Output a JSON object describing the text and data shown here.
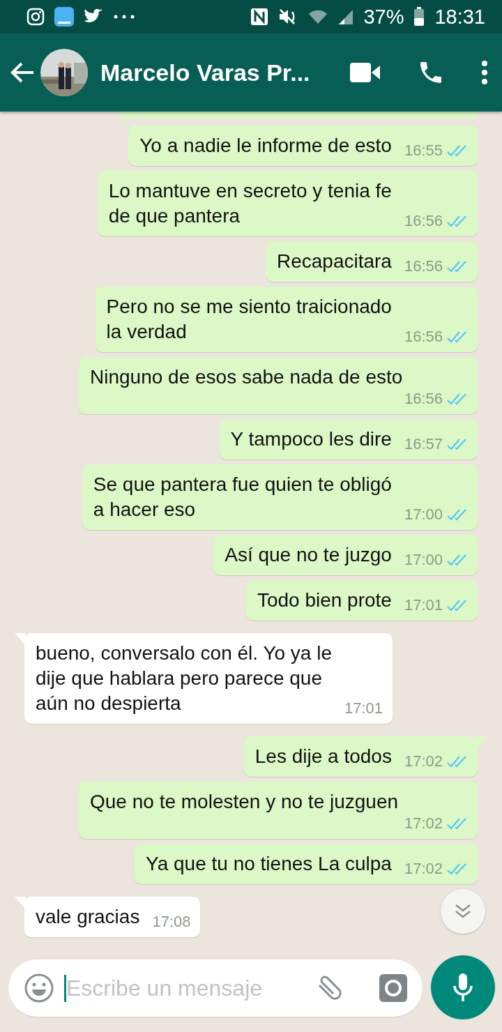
{
  "status_bar": {
    "battery": "37%",
    "time": "18:31"
  },
  "header": {
    "contact_name": "Marcelo Varas Pr..."
  },
  "messages": [
    {
      "kind": "out",
      "text": "Yo a nadie le informe de esto",
      "time": "16:55",
      "read": true,
      "tail": false
    },
    {
      "kind": "out",
      "text": "Lo mantuve en secreto y tenia fe\nde que pantera",
      "time": "16:56",
      "read": true,
      "tail": false
    },
    {
      "kind": "out",
      "text": "Recapacitara",
      "time": "16:56",
      "read": true,
      "tail": false
    },
    {
      "kind": "out",
      "text": "Pero no se me siento traicionado\nla verdad",
      "time": "16:56",
      "read": true,
      "tail": false
    },
    {
      "kind": "out",
      "text": "Ninguno de esos sabe nada de esto",
      "time": "16:56",
      "read": true,
      "tail": false
    },
    {
      "kind": "out",
      "text": "Y tampoco les dire",
      "time": "16:57",
      "read": true,
      "tail": false
    },
    {
      "kind": "out",
      "text": "Se que pantera fue quien te obligó\na hacer eso",
      "time": "17:00",
      "read": true,
      "tail": false
    },
    {
      "kind": "out",
      "text": "Así que no te juzgo",
      "time": "17:00",
      "read": true,
      "tail": false
    },
    {
      "kind": "out",
      "text": "Todo bien prote",
      "time": "17:01",
      "read": true,
      "tail": false
    },
    {
      "kind": "in",
      "text": "bueno, conversalo con él. Yo ya le\ndije que hablara pero parece que\naún no despierta",
      "time": "17:01",
      "tail": true
    },
    {
      "kind": "out",
      "text": "Les dije a todos",
      "time": "17:02",
      "read": true,
      "tail": true
    },
    {
      "kind": "out",
      "text": "Que no te molesten y no te juzguen",
      "time": "17:02",
      "read": true,
      "tail": false
    },
    {
      "kind": "out",
      "text": "Ya que tu no tienes La culpa",
      "time": "17:02",
      "read": true,
      "tail": false
    },
    {
      "kind": "in",
      "text": "vale gracias",
      "time": "17:08",
      "tail": true
    }
  ],
  "composer": {
    "placeholder": "Escribe un mensaje"
  }
}
